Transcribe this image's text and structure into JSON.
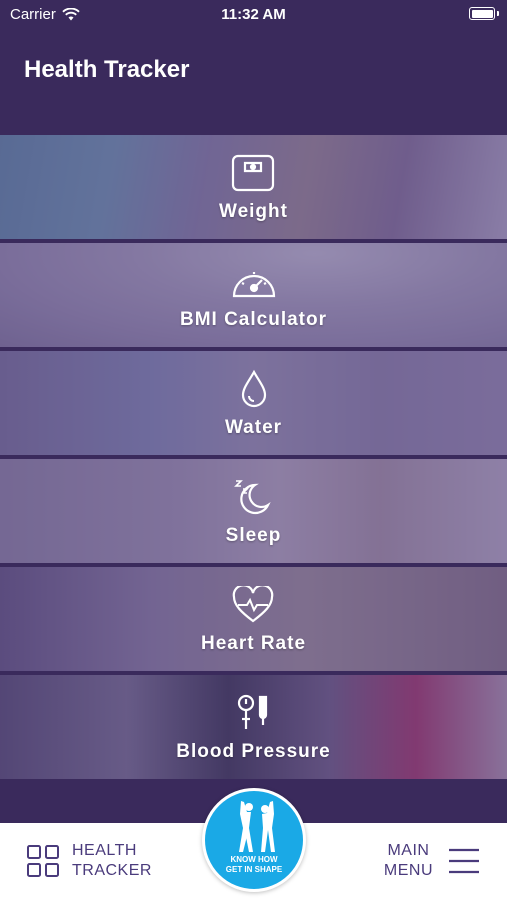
{
  "status_bar": {
    "carrier": "Carrier",
    "time": "11:32 AM"
  },
  "header": {
    "title": "Health Tracker"
  },
  "tiles": [
    {
      "label": "Weight",
      "icon": "scale-icon"
    },
    {
      "label": "BMI Calculator",
      "icon": "gauge-icon"
    },
    {
      "label": "Water",
      "icon": "water-drop-icon"
    },
    {
      "label": "Sleep",
      "icon": "moon-sleep-icon"
    },
    {
      "label": "Heart Rate",
      "icon": "heart-pulse-icon"
    },
    {
      "label": "Blood Pressure",
      "icon": "blood-pressure-icon"
    }
  ],
  "tab_bar": {
    "left_line1": "HEALTH",
    "left_line2": "TRACKER",
    "right_line1": "MAIN",
    "right_line2": "MENU",
    "logo_line1": "KNOW HOW",
    "logo_line2": "GET IN SHAPE"
  },
  "colors": {
    "header_bg": "#3a2a5c",
    "accent": "#4a3b7c",
    "logo_bg": "#1aa9e6"
  }
}
